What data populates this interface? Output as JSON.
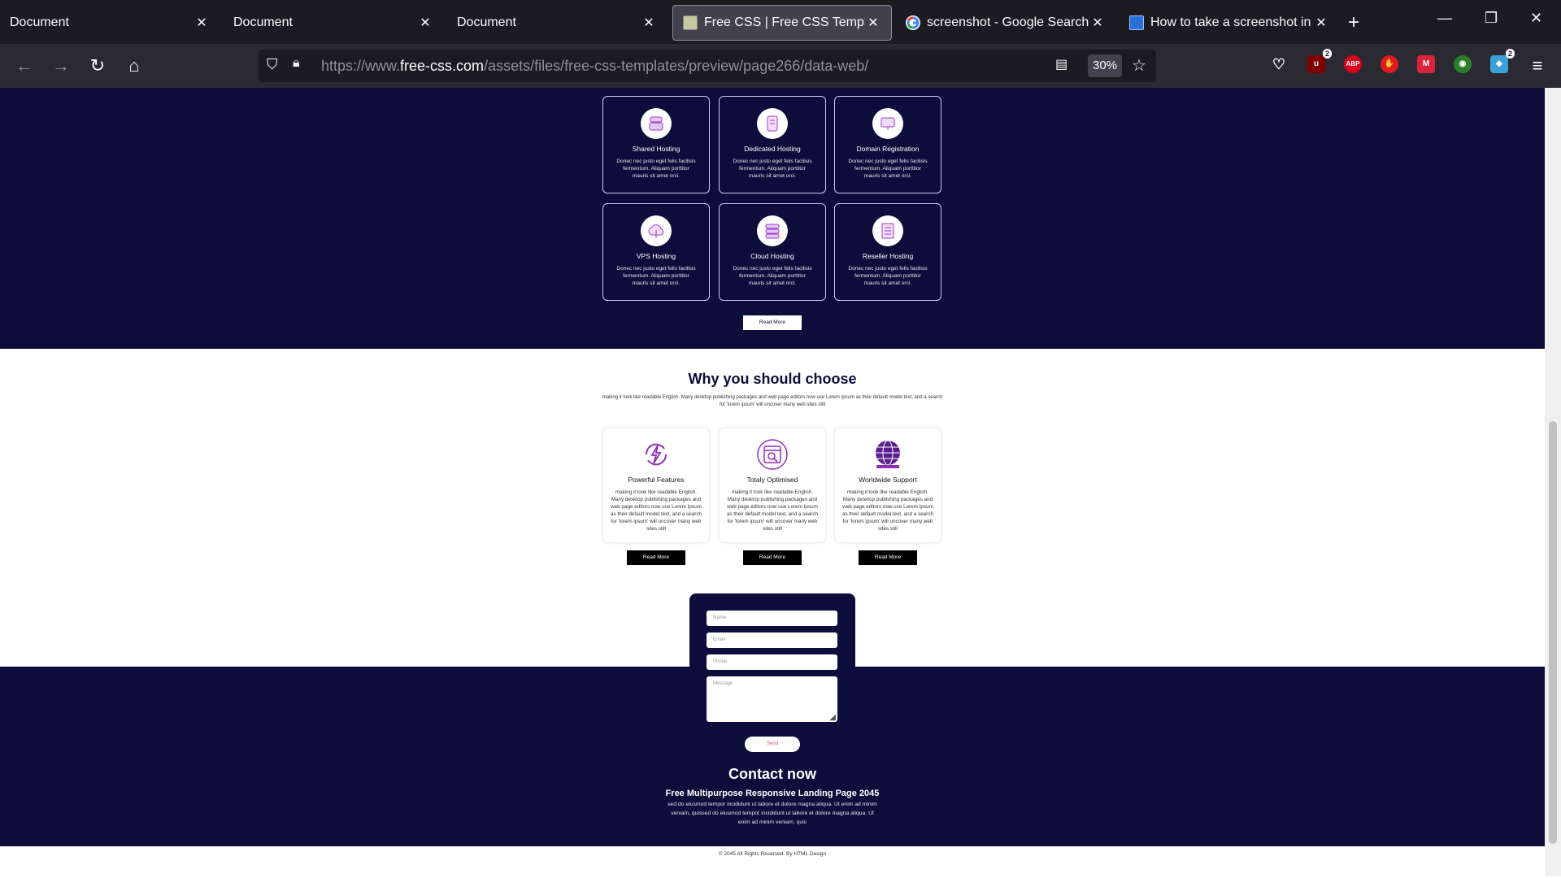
{
  "browser": {
    "tabs": [
      {
        "title": "Document",
        "active": false
      },
      {
        "title": "Document",
        "active": false
      },
      {
        "title": "Document",
        "active": false
      },
      {
        "title": "Free CSS | Free CSS Templates",
        "active": true
      },
      {
        "title": "screenshot - Google Search",
        "active": false
      },
      {
        "title": "How to take a screenshot in W",
        "active": false
      }
    ],
    "url_prefix": "https://www.",
    "url_host": "free-css.com",
    "url_path": "/assets/files/free-css-templates/preview/page266/data-web/",
    "zoom": "30%",
    "ext_badges": {
      "ublock": "2",
      "bitwarden": "2"
    },
    "ext_labels": {
      "abp": "ABP"
    }
  },
  "hosting": {
    "cards": [
      {
        "name": "Shared Hosting",
        "desc": "Donec nec justo eget felis facilisis fermentum. Aliquam porttitor mauris sit amet orci.",
        "icon": "shared-hosting-icon"
      },
      {
        "name": "Dedicated Hosting",
        "desc": "Donec nec justo eget felis facilisis fermentum. Aliquam porttitor mauris sit amet orci.",
        "icon": "dedicated-hosting-icon"
      },
      {
        "name": "Domain Registration",
        "desc": "Donec nec justo eget felis facilisis fermentum. Aliquam porttitor mauris sit amet orci.",
        "icon": "domain-registration-icon"
      },
      {
        "name": "VPS Hosting",
        "desc": "Donec nec justo eget felis facilisis fermentum. Aliquam porttitor mauris sit amet orci.",
        "icon": "cloud-icon"
      },
      {
        "name": "Cloud Hosting",
        "desc": "Donec nec justo eget felis facilisis fermentum. Aliquam porttitor mauris sit amet orci.",
        "icon": "server-icon"
      },
      {
        "name": "Reseller Hosting",
        "desc": "Donec nec justo eget felis facilisis fermentum. Aliquam porttitor mauris sit amet orci.",
        "icon": "reseller-icon"
      }
    ],
    "read_more": "Read More"
  },
  "why": {
    "title": "Why you should choose",
    "subtitle": "making it look like readable English. Many desktop publishing packages and web page editors now use Lorem Ipsum as their default model text, and a search for 'lorem ipsum' will uncover many web sites still",
    "features": [
      {
        "name": "Powerful Features",
        "desc": "making it look like readable English. Many desktop publishing packages and web page editors now use Lorem Ipsum as their default model text, and a search for 'lorem ipsum' will uncover many web sites still",
        "button": "Read More"
      },
      {
        "name": "Totaly Optimised",
        "desc": "making it look like readable English. Many desktop publishing packages and web page editors now use Lorem Ipsum as their default model text, and a search for 'lorem ipsum' will uncover many web sites still",
        "button": "Read More"
      },
      {
        "name": "Worldwide Support",
        "desc": "making it look like readable English. Many desktop publishing packages and web page editors now use Lorem Ipsum as their default model text, and a search for 'lorem ipsum' will uncover many web sites still",
        "button": "Read More"
      }
    ]
  },
  "form": {
    "name_placeholder": "Name",
    "email_placeholder": "Email",
    "phone_placeholder": "Phone",
    "message_placeholder": "Message",
    "send": "Send"
  },
  "contact": {
    "title": "Contact now",
    "subtitle": "Free Multipurpose Responsive Landing Page 2045",
    "desc": "sed do eiusmod tempor incididunt ut labore et dolore magna aliqua. Ut enim ad minim veniam, quissed do eiusmod tempor incididunt ut labore et dolore magna aliqua. Ut enim ad minim veniam, quis"
  },
  "footer": {
    "copyright": "© 2045 All Rights Reserved. By HTML.Design"
  },
  "colors": {
    "navy": "#0c0d3a",
    "purple": "#8e2db8",
    "pink": "#e84a7f"
  }
}
